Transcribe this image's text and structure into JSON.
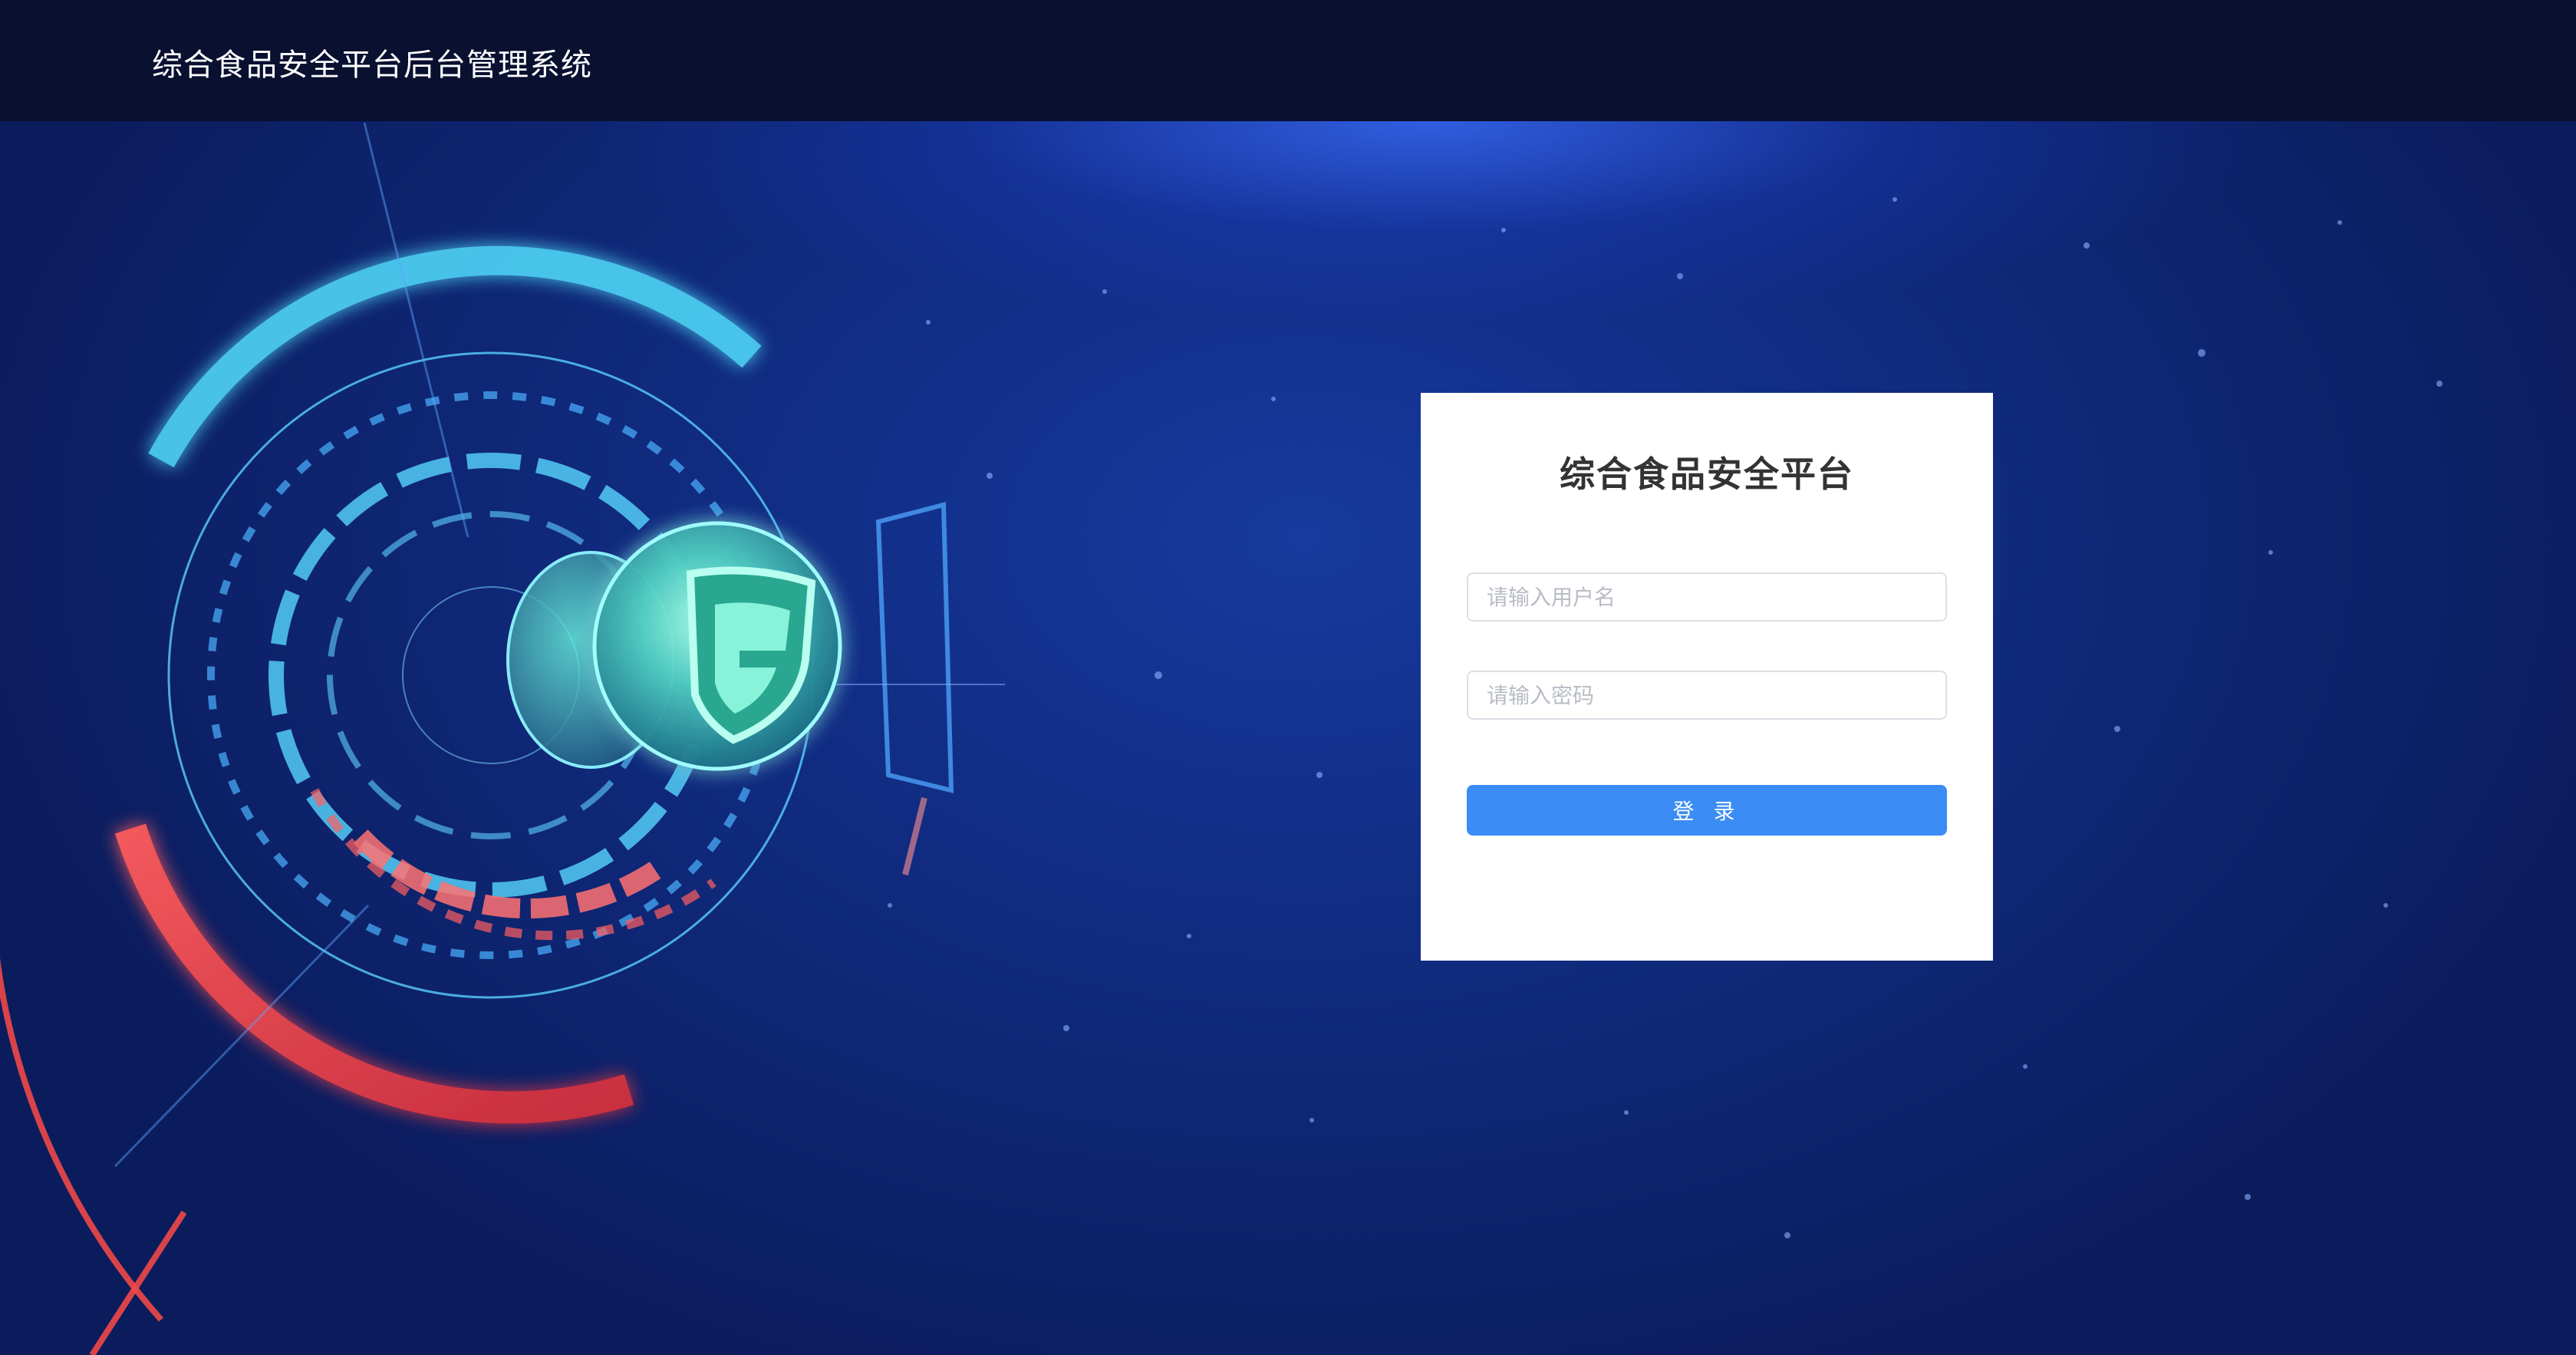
{
  "app": {
    "title": "综合食品安全平台后台管理系统"
  },
  "login": {
    "title": "综合食品安全平台",
    "username_placeholder": "请输入用户名",
    "password_placeholder": "请输入密码",
    "submit_label": "登 录"
  },
  "colors": {
    "topbar": "#091030",
    "background": "#102b80",
    "primary": "#3b8cf5",
    "accent_cyan": "#52d4f5",
    "accent_red": "#ef4848"
  },
  "icons": {
    "hero_emblem": "shield-g-icon"
  }
}
